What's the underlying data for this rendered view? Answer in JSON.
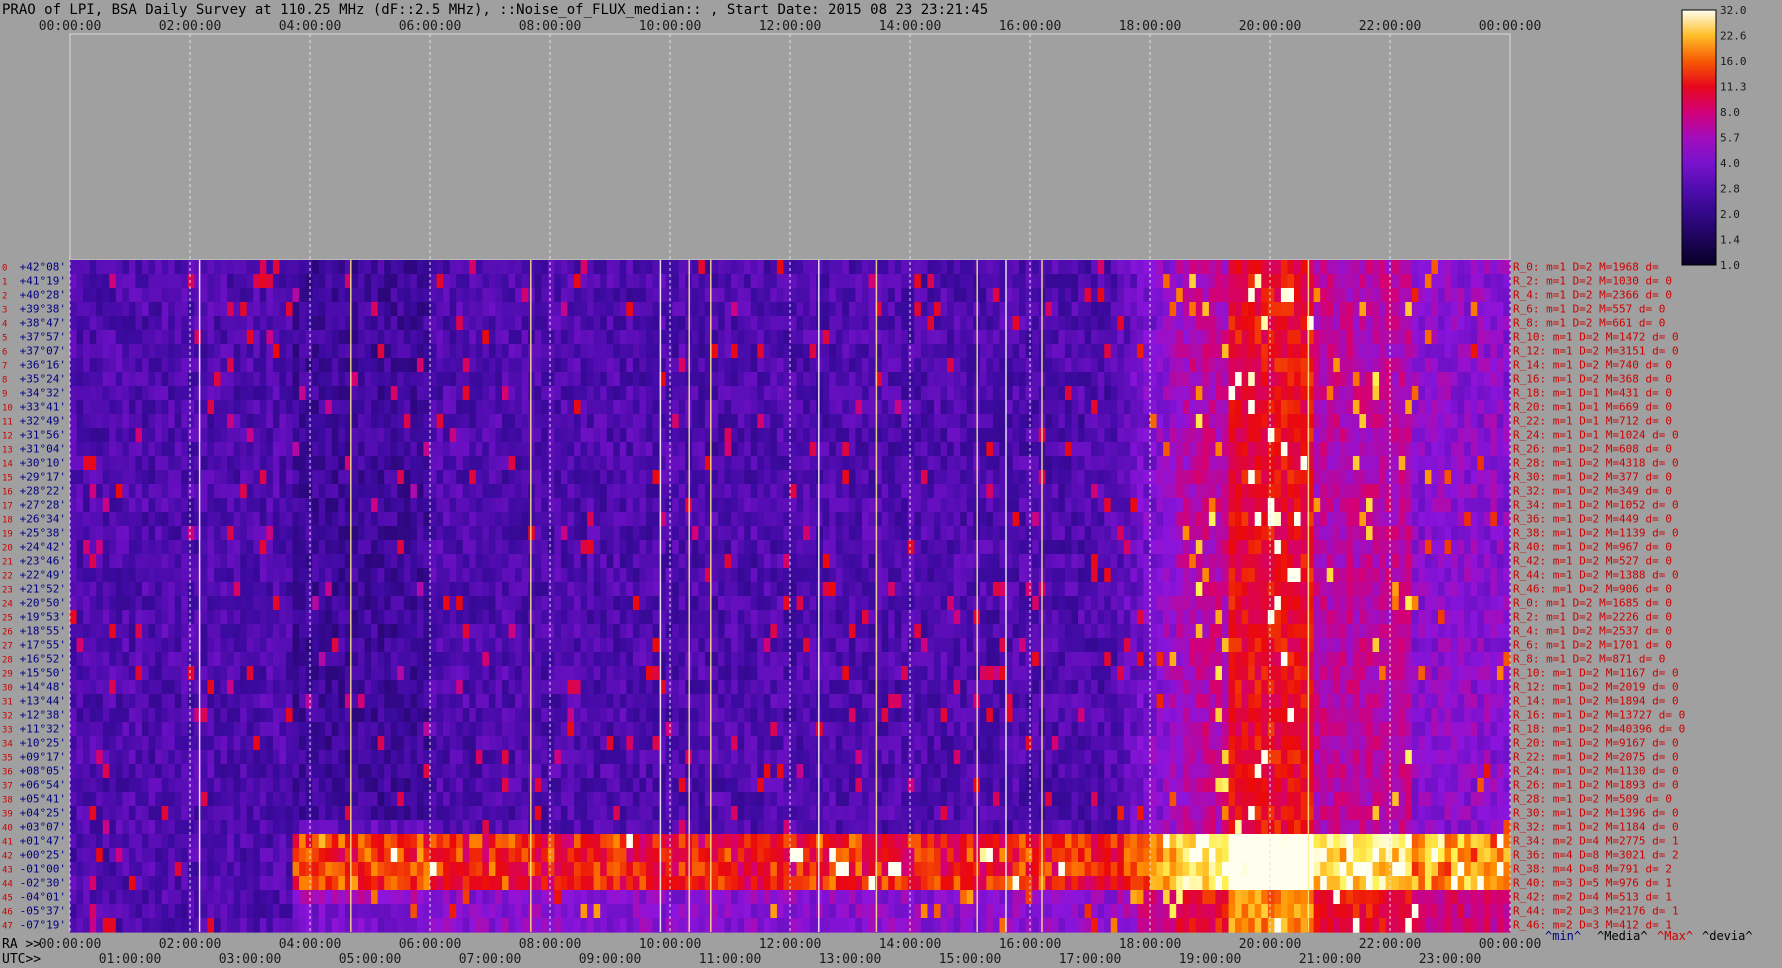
{
  "chart_data": {
    "type": "heatmap",
    "title": "PRAO of LPI, BSA Daily Survey at 110.25 MHz (dF::2.5 MHz), ::Noise_of_FLUX_median:: , Start Date: 2015 08 23 23:21:45",
    "top_axis_ticks": [
      "00:00:00",
      "02:00:00",
      "04:00:00",
      "06:00:00",
      "08:00:00",
      "10:00:00",
      "12:00:00",
      "14:00:00",
      "16:00:00",
      "18:00:00",
      "20:00:00",
      "22:00:00",
      "00:00:00"
    ],
    "ra_axis_label": "RA >>",
    "ra_ticks": [
      "00:00:00",
      "02:00:00",
      "04:00:00",
      "06:00:00",
      "08:00:00",
      "10:00:00",
      "12:00:00",
      "14:00:00",
      "16:00:00",
      "18:00:00",
      "20:00:00",
      "22:00:00",
      "00:00:00"
    ],
    "utc_axis_label": "UTC>>",
    "utc_ticks": [
      "01:00:00",
      "03:00:00",
      "05:00:00",
      "07:00:00",
      "09:00:00",
      "11:00:00",
      "13:00:00",
      "15:00:00",
      "17:00:00",
      "19:00:00",
      "21:00:00",
      "23:00:00"
    ],
    "colorbar": {
      "ticks": [
        "32.0",
        "22.6",
        "16.0",
        "11.3",
        "8.0",
        "5.7",
        "4.0",
        "2.8",
        "2.0",
        "1.4",
        "1.0"
      ],
      "scale": "log"
    },
    "rows": [
      {
        "dec": "+42°08'",
        "info": "R_0: m=1 D=2 M=1968 d="
      },
      {
        "dec": "+41°19'",
        "info": "R_2: m=1 D=2 M=1030 d= 0"
      },
      {
        "dec": "+40°28'",
        "info": "R_4: m=1 D=2 M=2366 d= 0"
      },
      {
        "dec": "+39°38'",
        "info": "R_6: m=1 D=2 M=557 d= 0"
      },
      {
        "dec": "+38°47'",
        "info": "R_8: m=1 D=2 M=661 d= 0"
      },
      {
        "dec": "+37°57'",
        "info": "R_10: m=1 D=2 M=1472 d= 0"
      },
      {
        "dec": "+37°07'",
        "info": "R_12: m=1 D=2 M=3151 d= 0"
      },
      {
        "dec": "+36°16'",
        "info": "R_14: m=1 D=2 M=740 d= 0"
      },
      {
        "dec": "+35°24'",
        "info": "R_16: m=1 D=2 M=368 d= 0"
      },
      {
        "dec": "+34°32'",
        "info": "R_18: m=1 D=1 M=431 d= 0"
      },
      {
        "dec": "+33°41'",
        "info": "R_20: m=1 D=1 M=669 d= 0"
      },
      {
        "dec": "+32°49'",
        "info": "R_22: m=1 D=1 M=712 d= 0"
      },
      {
        "dec": "+31°56'",
        "info": "R_24: m=1 D=1 M=1024 d= 0"
      },
      {
        "dec": "+31°04'",
        "info": "R_26: m=1 D=2 M=608 d= 0"
      },
      {
        "dec": "+30°10'",
        "info": "R_28: m=1 D=2 M=4318 d= 0"
      },
      {
        "dec": "+29°17'",
        "info": "R_30: m=1 D=2 M=377 d= 0"
      },
      {
        "dec": "+28°22'",
        "info": "R_32: m=1 D=2 M=349 d= 0"
      },
      {
        "dec": "+27°28'",
        "info": "R_34: m=1 D=2 M=1052 d= 0"
      },
      {
        "dec": "+26°34'",
        "info": "R_36: m=1 D=2 M=449 d= 0"
      },
      {
        "dec": "+25°38'",
        "info": "R_38: m=1 D=2 M=1139 d= 0"
      },
      {
        "dec": "+24°42'",
        "info": "R_40: m=1 D=2 M=967 d= 0"
      },
      {
        "dec": "+23°46'",
        "info": "R_42: m=1 D=2 M=527 d= 0"
      },
      {
        "dec": "+22°49'",
        "info": "R_44: m=1 D=2 M=1388 d= 0"
      },
      {
        "dec": "+21°52'",
        "info": "R_46: m=1 D=2 M=906 d= 0"
      },
      {
        "dec": "+20°50'",
        "info": "R_0: m=1 D=2 M=1685 d= 0"
      },
      {
        "dec": "+19°53'",
        "info": "R_2: m=1 D=2 M=2226 d= 0"
      },
      {
        "dec": "+18°55'",
        "info": "R_4: m=1 D=2 M=2537 d= 0"
      },
      {
        "dec": "+17°55'",
        "info": "R_6: m=1 D=2 M=1701 d= 0"
      },
      {
        "dec": "+16°52'",
        "info": "R_8: m=1 D=2 M=871 d= 0"
      },
      {
        "dec": "+15°50'",
        "info": "R_10: m=1 D=2 M=1167 d= 0"
      },
      {
        "dec": "+14°48'",
        "info": "R_12: m=1 D=2 M=2019 d= 0"
      },
      {
        "dec": "+13°44'",
        "info": "R_14: m=1 D=2 M=1894 d= 0"
      },
      {
        "dec": "+12°38'",
        "info": "R_16: m=1 D=2 M=13727 d= 0"
      },
      {
        "dec": "+11°32'",
        "info": "R_18: m=1 D=2 M=40396 d= 0"
      },
      {
        "dec": "+10°25'",
        "info": "R_20: m=1 D=2 M=9167 d= 0"
      },
      {
        "dec": "+09°17'",
        "info": "R_22: m=1 D=2 M=2075 d= 0"
      },
      {
        "dec": "+08°05'",
        "info": "R_24: m=1 D=2 M=1130 d= 0"
      },
      {
        "dec": "+06°54'",
        "info": "R_26: m=1 D=2 M=1893 d= 0"
      },
      {
        "dec": "+05°41'",
        "info": "R_28: m=1 D=2 M=509 d= 0"
      },
      {
        "dec": "+04°25'",
        "info": "R_30: m=1 D=2 M=1396 d= 0"
      },
      {
        "dec": "+03°07'",
        "info": "R_32: m=1 D=2 M=1184 d= 0"
      },
      {
        "dec": "+01°47'",
        "info": "R_34: m=2 D=4 M=2775 d= 1"
      },
      {
        "dec": "+00°25'",
        "info": "R_36: m=4 D=8 M=3021 d= 2"
      },
      {
        "dec": "-01°00'",
        "info": "R_38: m=4 D=8 M=791 d= 2"
      },
      {
        "dec": "-02°30'",
        "info": "R_40: m=3 D=5 M=976 d= 1"
      },
      {
        "dec": "-04°01'",
        "info": "R_42: m=2 D=4 M=513 d= 1"
      },
      {
        "dec": "-05°37'",
        "info": "R_44: m=2 D=3 M=2176 d= 1"
      },
      {
        "dec": "-07°19'",
        "info": "R_46: m=2 D=3 M=412 d= 1"
      }
    ],
    "summary_labels": {
      "min": "^min^",
      "media": "^Media^",
      "max": "^Max^",
      "devia": "^devia^"
    },
    "colors": {
      "background": "#a0a0a0",
      "row_info": "#cc0000",
      "dec_label": "#000080",
      "max_label": "#cc0000"
    }
  }
}
